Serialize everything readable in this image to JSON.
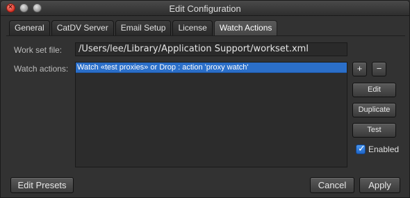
{
  "window": {
    "title": "Edit Configuration"
  },
  "tabs": [
    {
      "label": "General"
    },
    {
      "label": "CatDV Server"
    },
    {
      "label": "Email Setup"
    },
    {
      "label": "License"
    },
    {
      "label": "Watch Actions",
      "active": true
    }
  ],
  "workset": {
    "label": "Work set file:",
    "value": "/Users/lee/Library/Application Support/workset.xml"
  },
  "watch": {
    "label": "Watch actions:",
    "items": [
      {
        "text": "Watch «test proxies» or Drop : action 'proxy watch'",
        "selected": true
      }
    ]
  },
  "side_buttons": {
    "add": "+",
    "remove": "−",
    "edit": "Edit",
    "duplicate": "Duplicate",
    "test": "Test"
  },
  "enabled": {
    "label": "Enabled",
    "checked": true
  },
  "footer": {
    "edit_presets": "Edit Presets",
    "cancel": "Cancel",
    "apply": "Apply"
  },
  "colors": {
    "selection": "#2b6fc9",
    "accent_checkbox": "#1f66c8",
    "background": "#323232"
  }
}
